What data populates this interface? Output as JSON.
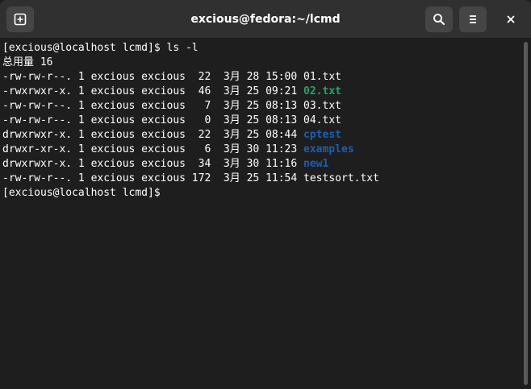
{
  "window": {
    "title": "excious@fedora:~/lcmd"
  },
  "icons": {
    "new_tab": "new-tab-icon",
    "search": "search-icon",
    "menu": "hamburger-menu-icon",
    "close": "close-icon"
  },
  "colors": {
    "executable": "#26a269",
    "directory": "#1a5fb4",
    "text": "#ffffff",
    "background": "#1e1e1e",
    "titlebar": "#303030"
  },
  "terminal": {
    "prompt1": "[excious@localhost lcmd]$ ls -l",
    "total": "总用量 16",
    "entries": [
      {
        "meta": "-rw-rw-r--. 1 excious excious  22  3月 28 15:00 ",
        "name": "01.txt",
        "kind": "file"
      },
      {
        "meta": "-rwxrwxr-x. 1 excious excious  46  3月 25 09:21 ",
        "name": "02.txt",
        "kind": "exec"
      },
      {
        "meta": "-rw-rw-r--. 1 excious excious   7  3月 25 08:13 ",
        "name": "03.txt",
        "kind": "file"
      },
      {
        "meta": "-rw-rw-r--. 1 excious excious   0  3月 25 08:13 ",
        "name": "04.txt",
        "kind": "file"
      },
      {
        "meta": "drwxrwxr-x. 1 excious excious  22  3月 25 08:44 ",
        "name": "cptest",
        "kind": "dir"
      },
      {
        "meta": "drwxr-xr-x. 1 excious excious   6  3月 30 11:23 ",
        "name": "examples",
        "kind": "dir"
      },
      {
        "meta": "drwxrwxr-x. 1 excious excious  34  3月 30 11:16 ",
        "name": "new1",
        "kind": "dir"
      },
      {
        "meta": "-rw-rw-r--. 1 excious excious 172  3月 25 11:54 ",
        "name": "testsort.txt",
        "kind": "file"
      }
    ],
    "prompt2": "[excious@localhost lcmd]$ "
  }
}
